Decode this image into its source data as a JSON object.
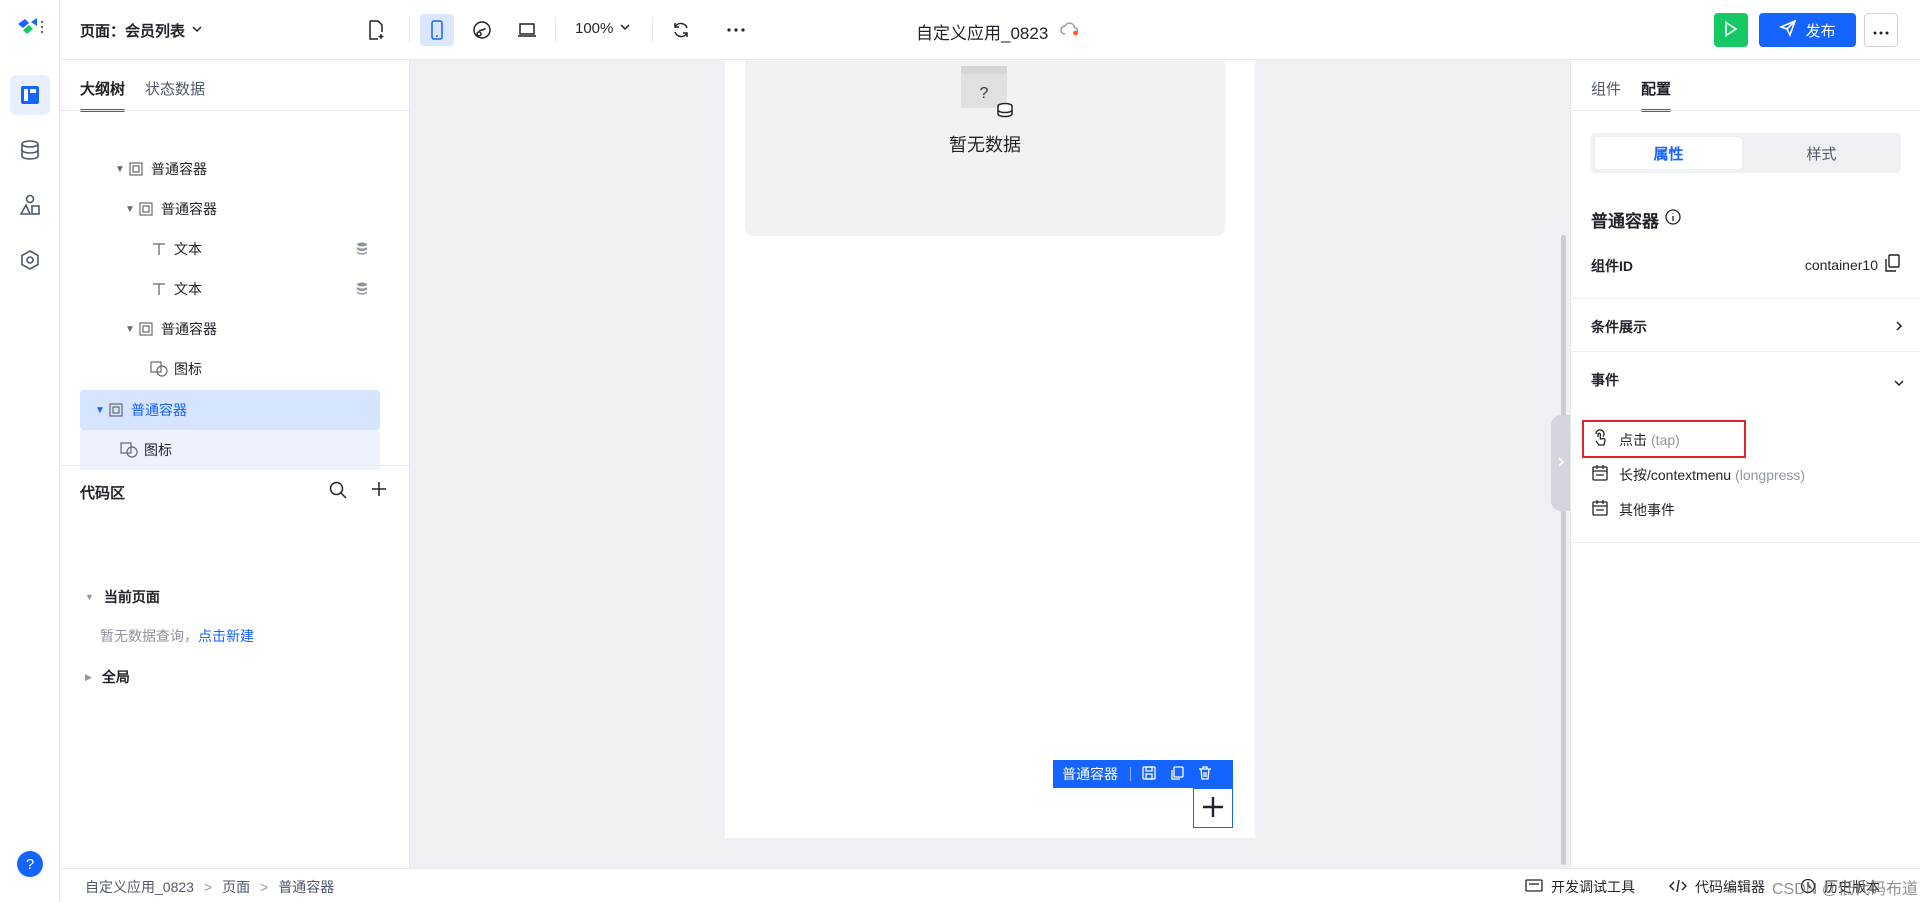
{
  "header": {
    "page_label": "页面：会员列表",
    "zoom": "100%",
    "app_title": "自定义应用_0823",
    "publish_label": "发布"
  },
  "left_panel": {
    "tabs": [
      "大纲树",
      "状态数据"
    ],
    "tree": [
      {
        "label": "普通容器"
      },
      {
        "label": "普通容器"
      },
      {
        "label": "文本"
      },
      {
        "label": "文本"
      },
      {
        "label": "普通容器"
      },
      {
        "label": "图标"
      },
      {
        "label": "普通容器"
      },
      {
        "label": "图标"
      }
    ],
    "code_area": {
      "title": "代码区",
      "current_page": "当前页面",
      "empty_text": "暂无数据查询，",
      "create_link": "点击新建",
      "global": "全局"
    }
  },
  "canvas": {
    "empty_text": "暂无数据",
    "empty_icon_glyph": "?",
    "selection_label": "普通容器"
  },
  "right_panel": {
    "tabs": [
      "组件",
      "配置"
    ],
    "segment": [
      "属性",
      "样式"
    ],
    "component_name": "普通容器",
    "id_label": "组件ID",
    "id_value": "container10",
    "conditional_label": "条件展示",
    "events_label": "事件",
    "events": [
      {
        "name": "点击",
        "code": "(tap)"
      },
      {
        "name": "长按/contextmenu",
        "code": "(longpress)"
      },
      {
        "name": "其他事件",
        "code": ""
      }
    ]
  },
  "bottom_bar": {
    "breadcrumb": [
      "自定义应用_0823",
      "页面",
      "普通容器"
    ],
    "sep": ">",
    "dev_tools": "开发调试工具",
    "code_editor": "代码编辑器",
    "history": "历史版本",
    "watermark": "CSDN @低代码布道师"
  },
  "colors": {
    "accent": "#1664ff",
    "run_button": "#17c964",
    "highlight_box": "#e0242a",
    "selection_bg": "#d6e4ff"
  }
}
